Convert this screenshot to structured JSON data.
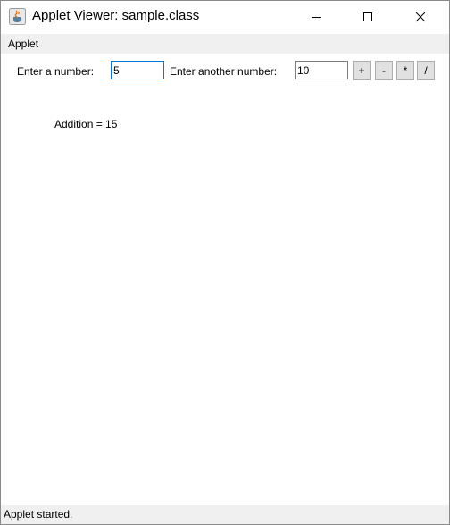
{
  "window": {
    "title": "Applet Viewer: sample.class",
    "app_icon": "java-cup-icon",
    "controls": {
      "minimize_icon": "minimize-icon",
      "maximize_icon": "maximize-icon",
      "close_icon": "close-icon"
    }
  },
  "menubar": {
    "items": [
      {
        "label": "Applet"
      }
    ]
  },
  "applet": {
    "first_label": "Enter a number:",
    "first_value": "5",
    "second_label": "Enter another number:",
    "second_value": "10",
    "operators": [
      "+",
      "-",
      "*",
      "/"
    ],
    "result_text": "Addition = 15"
  },
  "status": {
    "text": "Applet started."
  },
  "colors": {
    "focus_border": "#0078d7",
    "menubar_bg": "#f0f0f0",
    "button_bg": "#e1e1e1"
  }
}
